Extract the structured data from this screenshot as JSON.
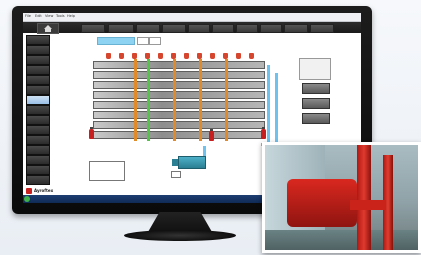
{
  "menubar": {
    "items": [
      "File",
      "Edit",
      "View",
      "Tools",
      "Help"
    ]
  },
  "toolbar": {
    "home_icon": "home-icon",
    "buttons": [
      "",
      "",
      "",
      "",
      "",
      "",
      "",
      "",
      "",
      ""
    ]
  },
  "sidebar": {
    "items": [
      "",
      "",
      "",
      "",
      "",
      "",
      "",
      "",
      "",
      "",
      "",
      "",
      "",
      "",
      ""
    ],
    "active_index": 6
  },
  "main": {
    "tag_label": "",
    "box1": "",
    "box2": ""
  },
  "right_panel": {
    "buttons": [
      "",
      "",
      ""
    ]
  },
  "bottom": {
    "label_left": "",
    "label_mid": "",
    "label_right": ""
  },
  "branding": {
    "logo_text": "Ayroftex"
  },
  "colors": {
    "accent_blue": "#8fd3f2",
    "pipe_orange": "#e08a2a",
    "pipe_green": "#55c24b",
    "sprinkler_red": "#d6462f",
    "toolbar_dark": "#1a1a1a"
  }
}
